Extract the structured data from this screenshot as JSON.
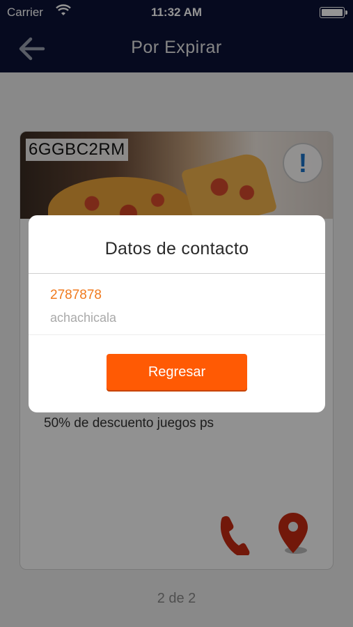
{
  "status_bar": {
    "carrier": "Carrier",
    "time": "11:32 AM"
  },
  "nav": {
    "title": "Por Expirar",
    "back_icon": "arrow-left-icon"
  },
  "card": {
    "code": "6GGBC2RM",
    "alert_icon": "exclamation-icon",
    "description": "50% de descuento juegos ps",
    "phone_icon": "phone-icon",
    "location_icon": "map-pin-icon"
  },
  "pager": {
    "text": "2 de 2"
  },
  "modal": {
    "title": "Datos de contacto",
    "phone": "2787878",
    "contact_name": "achachicala",
    "button_label": "Regresar"
  },
  "colors": {
    "nav_bg": "#0b1236",
    "accent_orange": "#ff5a04",
    "phone_text": "#f07a1e",
    "icon_red": "#c42a12"
  }
}
